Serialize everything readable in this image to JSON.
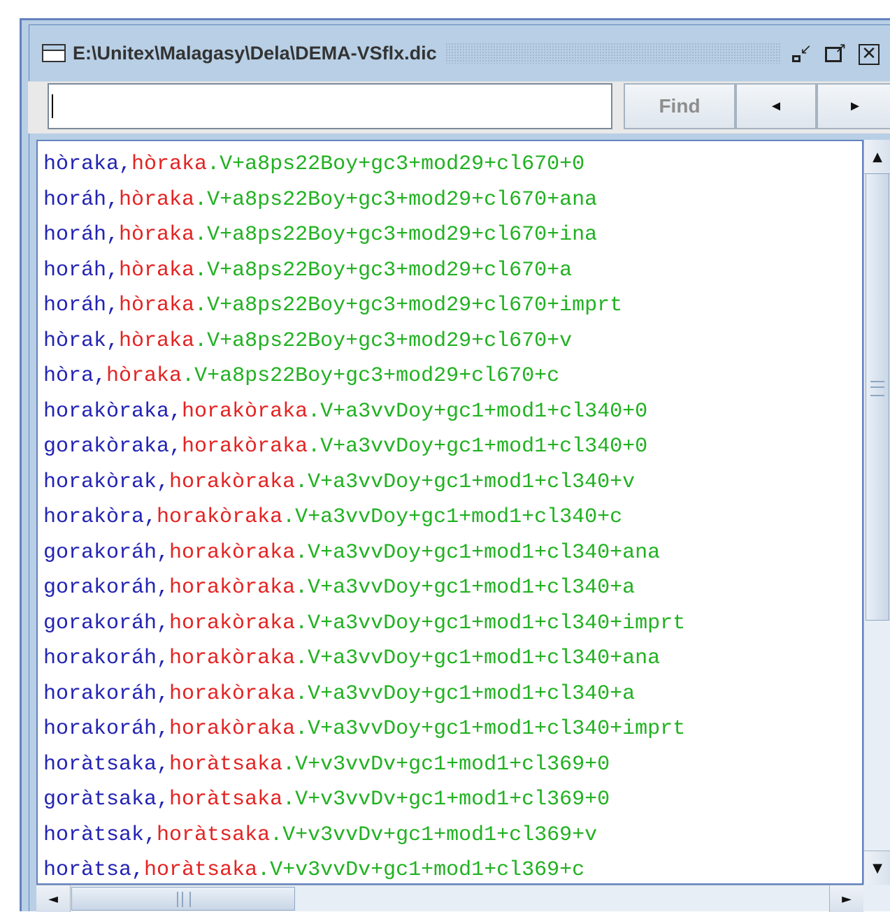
{
  "window": {
    "title": "E:\\Unitex\\Malagasy\\Dela\\DEMA-VSflx.dic",
    "iconify_label": "iconify",
    "maximize_label": "maximize",
    "close_label": "close"
  },
  "search": {
    "value": "",
    "find_label": "Find",
    "prev_glyph": "◄",
    "next_glyph": "►"
  },
  "icons": {
    "window": "window-icon",
    "up": "▲",
    "down": "▼",
    "left": "◄",
    "right": "►"
  },
  "colors": {
    "inflected": "#2323b3",
    "lemma": "#e32323",
    "codes": "#21b121",
    "frame": "#b8cfe5",
    "border": "#6382bf"
  },
  "entries": [
    {
      "inflected": "hòraka",
      "lemma": "hòraka",
      "codes": "V+a8ps22Boy+gc3+mod29+cl670+0"
    },
    {
      "inflected": "horáh",
      "lemma": "hòraka",
      "codes": "V+a8ps22Boy+gc3+mod29+cl670+ana"
    },
    {
      "inflected": "horáh",
      "lemma": "hòraka",
      "codes": "V+a8ps22Boy+gc3+mod29+cl670+ina"
    },
    {
      "inflected": "horáh",
      "lemma": "hòraka",
      "codes": "V+a8ps22Boy+gc3+mod29+cl670+a"
    },
    {
      "inflected": "horáh",
      "lemma": "hòraka",
      "codes": "V+a8ps22Boy+gc3+mod29+cl670+imprt"
    },
    {
      "inflected": "hòrak",
      "lemma": "hòraka",
      "codes": "V+a8ps22Boy+gc3+mod29+cl670+v"
    },
    {
      "inflected": "hòra",
      "lemma": "hòraka",
      "codes": "V+a8ps22Boy+gc3+mod29+cl670+c"
    },
    {
      "inflected": "horakòraka",
      "lemma": "horakòraka",
      "codes": "V+a3vvDoy+gc1+mod1+cl340+0"
    },
    {
      "inflected": "gorakòraka",
      "lemma": "horakòraka",
      "codes": "V+a3vvDoy+gc1+mod1+cl340+0"
    },
    {
      "inflected": "horakòrak",
      "lemma": "horakòraka",
      "codes": "V+a3vvDoy+gc1+mod1+cl340+v"
    },
    {
      "inflected": "horakòra",
      "lemma": "horakòraka",
      "codes": "V+a3vvDoy+gc1+mod1+cl340+c"
    },
    {
      "inflected": "gorakoráh",
      "lemma": "horakòraka",
      "codes": "V+a3vvDoy+gc1+mod1+cl340+ana"
    },
    {
      "inflected": "gorakoráh",
      "lemma": "horakòraka",
      "codes": "V+a3vvDoy+gc1+mod1+cl340+a"
    },
    {
      "inflected": "gorakoráh",
      "lemma": "horakòraka",
      "codes": "V+a3vvDoy+gc1+mod1+cl340+imprt"
    },
    {
      "inflected": "horakoráh",
      "lemma": "horakòraka",
      "codes": "V+a3vvDoy+gc1+mod1+cl340+ana"
    },
    {
      "inflected": "horakoráh",
      "lemma": "horakòraka",
      "codes": "V+a3vvDoy+gc1+mod1+cl340+a"
    },
    {
      "inflected": "horakoráh",
      "lemma": "horakòraka",
      "codes": "V+a3vvDoy+gc1+mod1+cl340+imprt"
    },
    {
      "inflected": "horàtsaka",
      "lemma": "horàtsaka",
      "codes": "V+v3vvDv+gc1+mod1+cl369+0"
    },
    {
      "inflected": "goràtsaka",
      "lemma": "horàtsaka",
      "codes": "V+v3vvDv+gc1+mod1+cl369+0"
    },
    {
      "inflected": "horàtsak",
      "lemma": "horàtsaka",
      "codes": "V+v3vvDv+gc1+mod1+cl369+v"
    },
    {
      "inflected": "horàtsa",
      "lemma": "horàtsaka",
      "codes": "V+v3vvDv+gc1+mod1+cl369+c"
    }
  ]
}
